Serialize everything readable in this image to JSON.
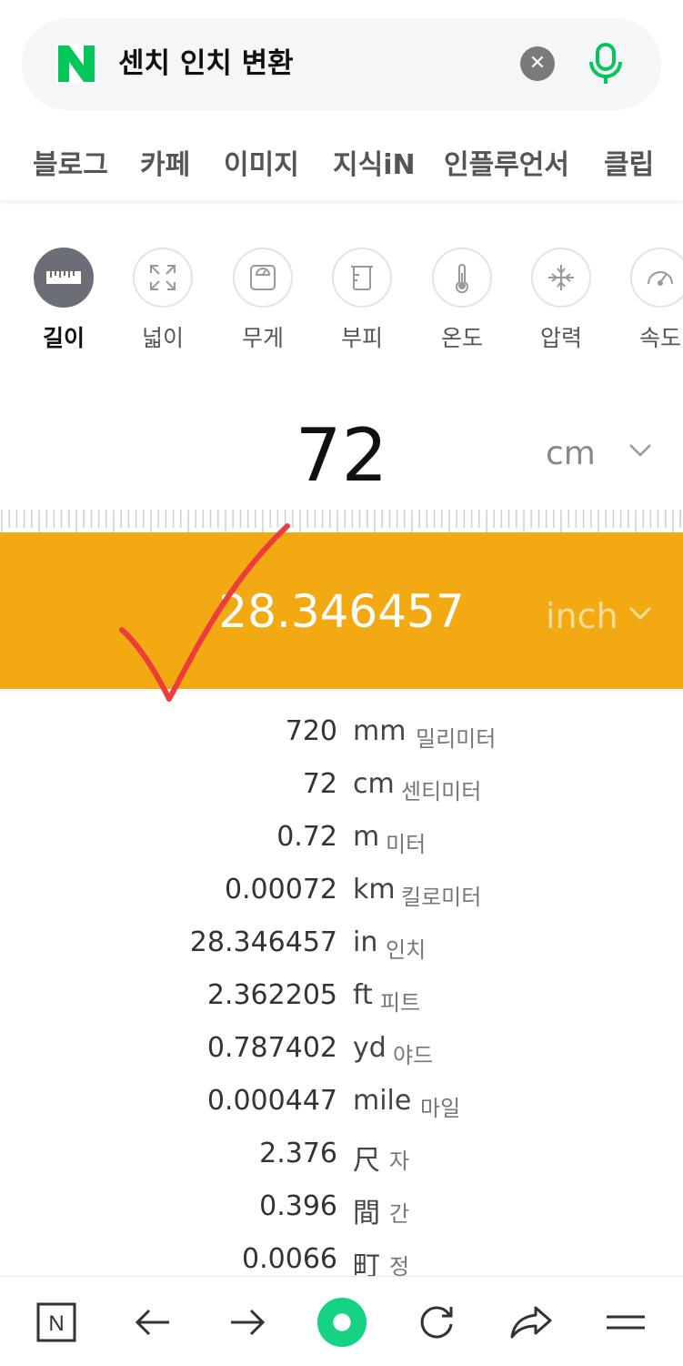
{
  "search": {
    "query": "센치 인치 변환",
    "logo_text": "N",
    "brand_color": "#03c75a"
  },
  "tabs": [
    "블로그",
    "카페",
    "이미지",
    "지식iN",
    "인플루언서",
    "클립"
  ],
  "categories": [
    {
      "label": "길이",
      "icon": "ruler-icon",
      "active": true
    },
    {
      "label": "넓이",
      "icon": "area-expand-icon",
      "active": false
    },
    {
      "label": "무게",
      "icon": "scale-icon",
      "active": false
    },
    {
      "label": "부피",
      "icon": "beaker-icon",
      "active": false
    },
    {
      "label": "온도",
      "icon": "thermometer-icon",
      "active": false
    },
    {
      "label": "압력",
      "icon": "pressure-icon",
      "active": false
    },
    {
      "label": "속도",
      "icon": "speedometer-icon",
      "active": false
    }
  ],
  "converter": {
    "input_value": "72",
    "input_unit": "cm",
    "output_value": "28.346457",
    "output_unit": "inch",
    "accent_color": "#f3a912"
  },
  "conversions": [
    {
      "value": "720",
      "unit": "mm",
      "name": "밀리미터"
    },
    {
      "value": "72",
      "unit": "cm",
      "name": "센티미터"
    },
    {
      "value": "0.72",
      "unit": "m",
      "name": "미터"
    },
    {
      "value": "0.00072",
      "unit": "km",
      "name": "킬로미터"
    },
    {
      "value": "28.346457",
      "unit": "in",
      "name": "인치"
    },
    {
      "value": "2.362205",
      "unit": "ft",
      "name": "피트"
    },
    {
      "value": "0.787402",
      "unit": "yd",
      "name": "야드"
    },
    {
      "value": "0.000447",
      "unit": "mile",
      "name": "마일"
    },
    {
      "value": "2.376",
      "unit": "尺",
      "name": "자"
    },
    {
      "value": "0.396",
      "unit": "間",
      "name": "간"
    },
    {
      "value": "0.0066",
      "unit": "町",
      "name": "정"
    }
  ],
  "bottom_nav": {
    "home_label": "N",
    "icons": [
      "naver-home-icon",
      "back-arrow-icon",
      "forward-arrow-icon",
      "green-dot-icon",
      "refresh-icon",
      "share-icon",
      "menu-icon"
    ]
  }
}
